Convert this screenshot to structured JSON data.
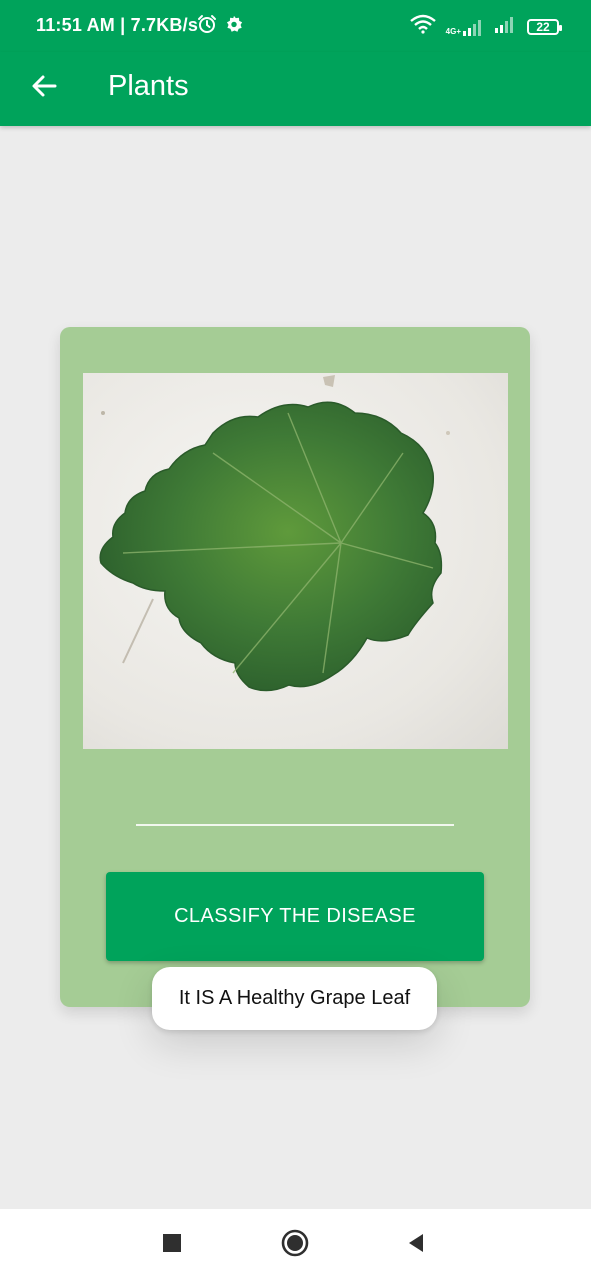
{
  "status_bar": {
    "time": "11:51 AM | 7.7KB/s",
    "network_type": "4G+",
    "battery": "22",
    "icons": [
      "alarm-icon",
      "settings-gear-icon",
      "wifi-icon",
      "signal-icon",
      "signal-icon",
      "battery-icon"
    ]
  },
  "app_bar": {
    "title": "Plants",
    "back_icon": "arrow-back-icon"
  },
  "card": {
    "image_description_icon": "grape-leaf-photo",
    "button_label": "CLASSIFY THE DISEASE"
  },
  "toast": {
    "message": "It IS A Healthy Grape Leaf"
  },
  "nav_bar": {
    "icons": [
      "recents-square-icon",
      "home-circle-icon",
      "back-triangle-icon"
    ]
  },
  "colors": {
    "primary": "#00a35b",
    "card_background": "#a5cc95",
    "page_background": "#ececec"
  }
}
